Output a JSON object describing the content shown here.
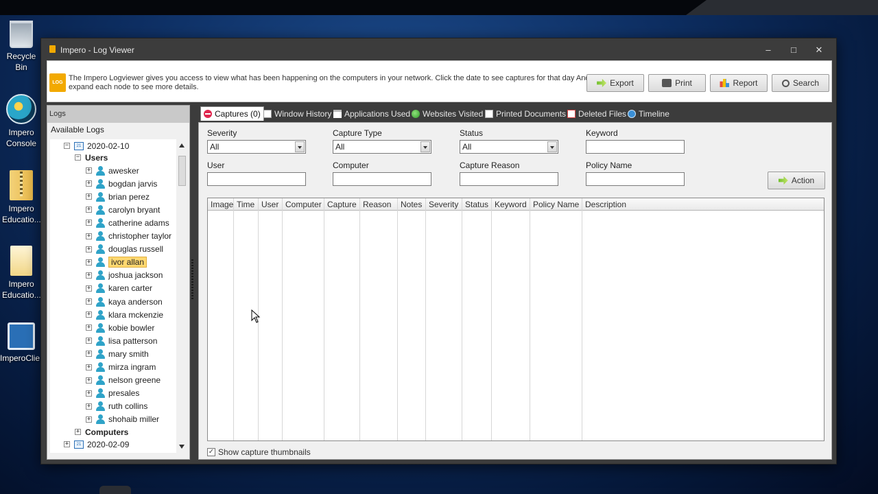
{
  "desktop": {
    "icons": [
      {
        "label": "Recycle Bin",
        "icon": "recycle-bin-icon"
      },
      {
        "label": "Impero Console",
        "icon": "impero-console-icon"
      },
      {
        "label": "Impero Educatio...",
        "icon": "zip-folder-icon"
      },
      {
        "label": "Impero Educatio...",
        "icon": "file-icon"
      },
      {
        "label": "ImperoClie...",
        "icon": "installer-icon"
      }
    ]
  },
  "window": {
    "title": "Impero - Log Viewer",
    "controls": {
      "minimize": "–",
      "maximize": "□",
      "close": "✕"
    }
  },
  "infobar": {
    "badge": "LOG",
    "text": "The Impero Logviewer gives you access to view what has been happening on the computers in your network. Click the date to see captures for that day And expand each node to see more details.",
    "buttons": {
      "export": "Export",
      "print": "Print",
      "report": "Report",
      "search": "Search"
    }
  },
  "left": {
    "header": "Logs",
    "subheader": "Available Logs",
    "tree": {
      "date1": "2020-02-10",
      "users_label": "Users",
      "users": [
        "awesker",
        "bogdan jarvis",
        "brian perez",
        "carolyn bryant",
        "catherine adams",
        "christopher taylor",
        "douglas russell",
        "ivor allan",
        "joshua jackson",
        "karen carter",
        "kaya anderson",
        "klara mckenzie",
        "kobie bowler",
        "lisa patterson",
        "mary smith",
        "mirza ingram",
        "nelson greene",
        "presales",
        "ruth collins",
        "shohaib miller"
      ],
      "selected_user": "ivor allan",
      "computers_label": "Computers",
      "date2": "2020-02-09",
      "calendar_glyph": "21"
    }
  },
  "tabs": [
    {
      "label": "Captures (0)",
      "icon": "captures-icon",
      "active": true
    },
    {
      "label": "Window History",
      "icon": "window-history-icon",
      "active": false
    },
    {
      "label": "Applications Used",
      "icon": "applications-icon",
      "active": false
    },
    {
      "label": "Websites Visited",
      "icon": "globe-icon",
      "active": false
    },
    {
      "label": "Printed Documents",
      "icon": "printer-icon",
      "active": false
    },
    {
      "label": "Deleted Files",
      "icon": "deleted-files-icon",
      "active": false
    },
    {
      "label": "Timeline",
      "icon": "clock-icon",
      "active": false
    }
  ],
  "filters": {
    "severity": {
      "label": "Severity",
      "value": "All"
    },
    "capture_type": {
      "label": "Capture Type",
      "value": "All"
    },
    "status": {
      "label": "Status",
      "value": "All"
    },
    "keyword": {
      "label": "Keyword",
      "value": ""
    },
    "user": {
      "label": "User",
      "value": ""
    },
    "computer": {
      "label": "Computer",
      "value": ""
    },
    "capture_reason": {
      "label": "Capture Reason",
      "value": ""
    },
    "policy_name": {
      "label": "Policy Name",
      "value": ""
    },
    "action_button": "Action"
  },
  "grid": {
    "columns": [
      "Image",
      "Time",
      "User",
      "Computer",
      "Capture",
      "Reason",
      "Notes",
      "Severity",
      "Status",
      "Keyword",
      "Policy Name",
      "Description"
    ],
    "rows": []
  },
  "footer": {
    "show_thumbnails_label": "Show capture thumbnails",
    "show_thumbnails_checked": true
  },
  "colors": {
    "window_chrome": "#3c3c3c",
    "accent": "#f2a900",
    "selection": "#ffd870",
    "user_icon": "#2fa3c8"
  }
}
